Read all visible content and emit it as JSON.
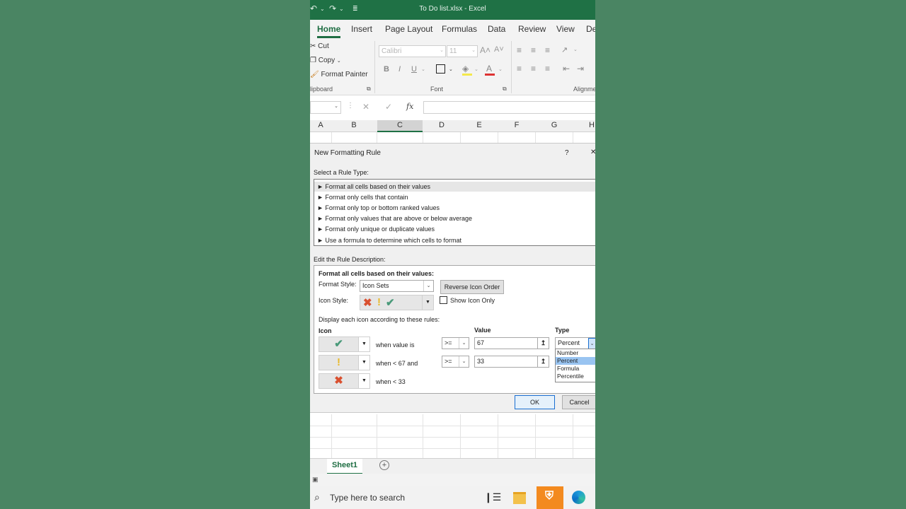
{
  "window_title": "To Do list.xlsx  -  Excel",
  "ribbon_tabs": [
    "Home",
    "Insert",
    "Page Layout",
    "Formulas",
    "Data",
    "Review",
    "View",
    "De"
  ],
  "clipboard": {
    "cut": "Cut",
    "copy": "Copy",
    "format_painter": "Format Painter",
    "group": "lipboard"
  },
  "font": {
    "name": "Calibri",
    "size": "11",
    "group": "Font",
    "grow": "A˄",
    "shrink": "A˅",
    "bold": "B",
    "italic": "I",
    "underline": "U"
  },
  "alignment": {
    "group": "Alignme"
  },
  "formula_bar": {
    "fx": "fx"
  },
  "columns": [
    "A",
    "B",
    "C",
    "D",
    "E",
    "F",
    "G",
    "H"
  ],
  "dialog": {
    "title": "New Formatting Rule",
    "help": "?",
    "close": "✕",
    "select_rule_label": "Select a Rule Type:",
    "rules": [
      "► Format all cells based on their values",
      "► Format only cells that contain",
      "► Format only top or bottom ranked values",
      "► Format only values that are above or below average",
      "► Format only unique or duplicate values",
      "► Use a formula to determine which cells to format"
    ],
    "edit_label": "Edit the Rule Description:",
    "desc_heading": "Format all cells based on their values:",
    "format_style_label": "Format Style:",
    "format_style_value": "Icon Sets",
    "reverse_button": "Reverse Icon Order",
    "icon_style_label": "Icon Style:",
    "show_icon_only": "Show Icon Only",
    "display_rules_label": "Display each icon according to these rules:",
    "col_icon": "Icon",
    "col_value": "Value",
    "col_type": "Type",
    "rows": [
      {
        "icon": "check-icon",
        "text": "when value is",
        "op": ">=",
        "value": "67",
        "type": "Percent"
      },
      {
        "icon": "exclamation-icon",
        "text": "when < 67 and",
        "op": ">=",
        "value": "33",
        "type": ""
      },
      {
        "icon": "cross-icon",
        "text": "when < 33"
      }
    ],
    "type_options": [
      "Number",
      "Percent",
      "Formula",
      "Percentile"
    ],
    "type_selected": "Percent",
    "ok": "OK",
    "cancel": "Cancel"
  },
  "sheet_tab": "Sheet1",
  "taskbar": {
    "search_placeholder": "Type here to search"
  },
  "colors": {
    "excel_green": "#1f7145",
    "background": "#4a8563",
    "check": "#4a9a7a",
    "cross": "#d9502f",
    "exclaim": "#e8b92b",
    "highlight": "#99c4f1"
  }
}
